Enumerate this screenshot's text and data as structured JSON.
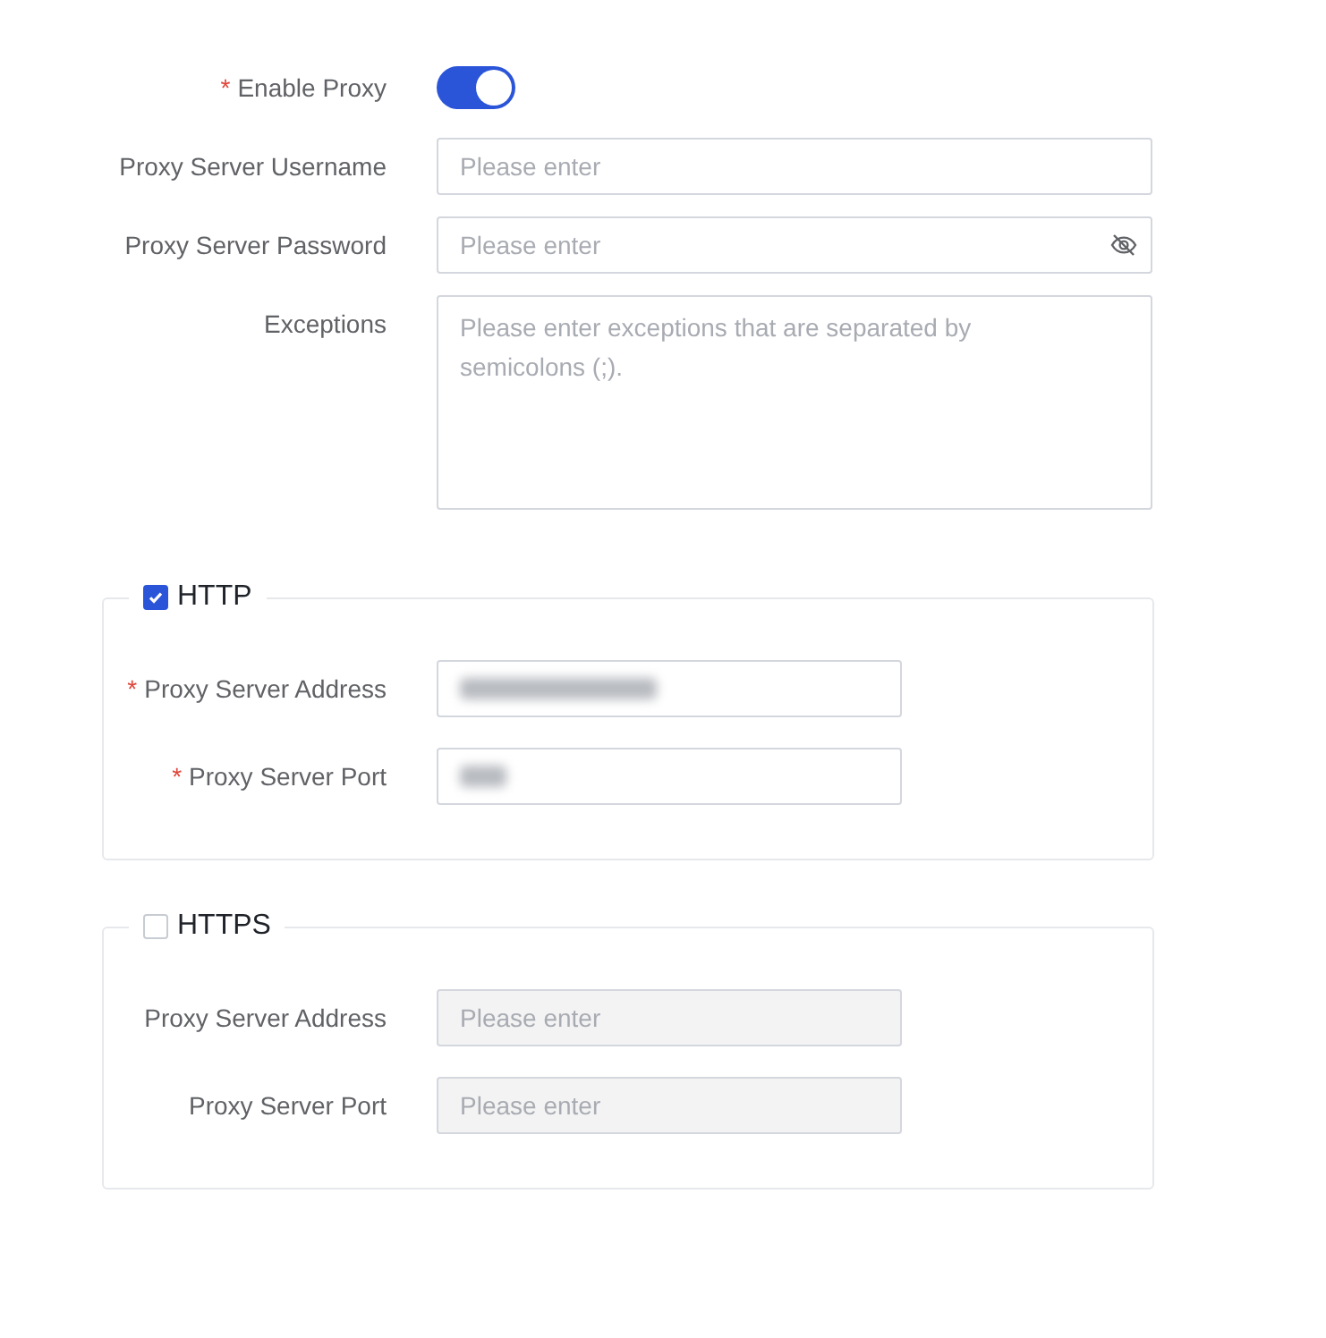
{
  "enable_proxy": {
    "required_mark": "*",
    "label": "Enable Proxy",
    "on": true
  },
  "fields": [
    {
      "kind": "text",
      "label": "Proxy Server Username",
      "placeholder": "Please enter"
    },
    {
      "kind": "password",
      "label": "Proxy Server Password",
      "placeholder": "Please enter"
    },
    {
      "kind": "textarea",
      "label": "Exceptions",
      "placeholder": "Please enter exceptions that are separated by semicolons (;)."
    }
  ],
  "sections": [
    {
      "title": "HTTP",
      "checked": true,
      "fields": [
        {
          "required_mark": "*",
          "label": "Proxy Server Address",
          "disabled": false,
          "value_redacted": true
        },
        {
          "required_mark": "*",
          "label": "Proxy Server Port",
          "disabled": false,
          "value_redacted": true
        }
      ]
    },
    {
      "title": "HTTPS",
      "checked": false,
      "fields": [
        {
          "label": "Proxy Server Address",
          "disabled": true,
          "placeholder": "Please enter"
        },
        {
          "label": "Proxy Server Port",
          "disabled": true,
          "placeholder": "Please enter"
        }
      ]
    }
  ]
}
